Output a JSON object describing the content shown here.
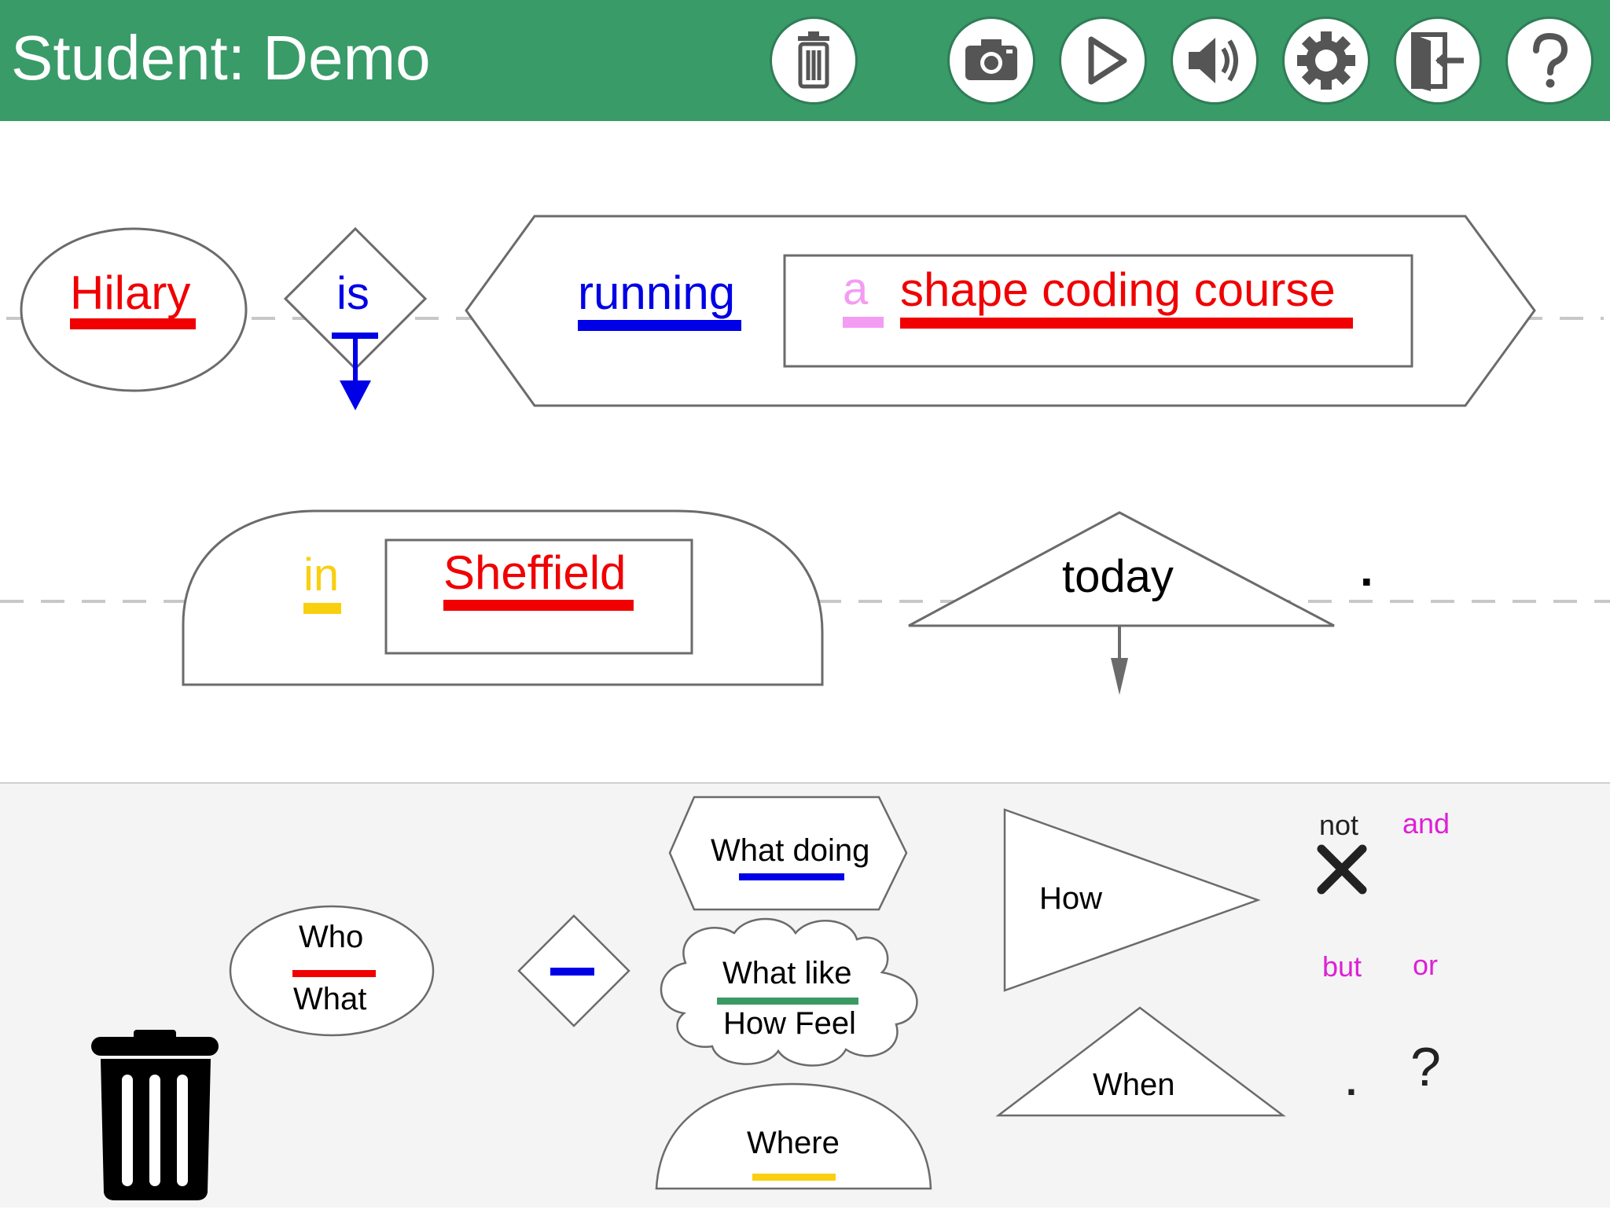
{
  "header": {
    "title": "Student: Demo",
    "buttons": [
      {
        "name": "trash-button",
        "icon": "trash-icon"
      },
      {
        "name": "camera-button",
        "icon": "camera-icon"
      },
      {
        "name": "play-button",
        "icon": "play-icon"
      },
      {
        "name": "sound-button",
        "icon": "speaker-icon"
      },
      {
        "name": "settings-button",
        "icon": "gear-icon"
      },
      {
        "name": "exit-button",
        "icon": "exit-icon"
      },
      {
        "name": "help-button",
        "icon": "help-icon"
      }
    ],
    "background": "#399b68"
  },
  "sentence": {
    "line1": {
      "who": "Hilary",
      "verb": "is",
      "doing": "running",
      "article": "a",
      "object": "shape coding course"
    },
    "line2": {
      "preposition": "in",
      "place": "Sheffield",
      "when": "today",
      "end_mark": "."
    }
  },
  "palette": {
    "who_top": "Who",
    "who_bottom": "What",
    "what_doing": "What doing",
    "what_like": "What like",
    "how_feel": "How Feel",
    "where": "Where",
    "how": "How",
    "when": "When",
    "not_label": "not",
    "and": "and",
    "but": "but",
    "or": "or",
    "period": ".",
    "question": "?"
  },
  "colors": {
    "red": "#f00000",
    "blue": "#0000e6",
    "pink": "#f39cf3",
    "yellow": "#f9cf0f",
    "green": "#3b9a63",
    "magenta": "#de1fd6",
    "shape_stroke": "#6b6b6b"
  }
}
